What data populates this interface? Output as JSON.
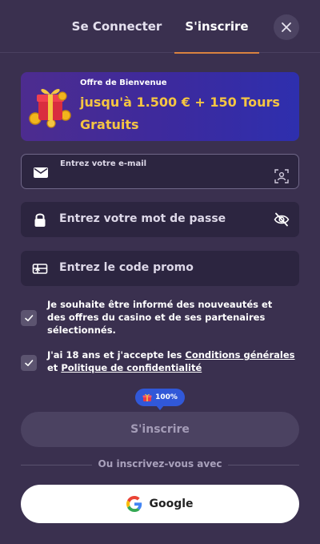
{
  "tabs": {
    "login": "Se Connecter",
    "register": "S'inscrire"
  },
  "promo": {
    "small": "Offre de Bienvenue",
    "big": "jusqu'à 1.500 € + 150 Tours Gratuits"
  },
  "fields": {
    "email_label": "Entrez votre e-mail",
    "password_placeholder": "Entrez votre mot de passe",
    "promo_placeholder": "Entrez le code promo"
  },
  "checkboxes": {
    "newsletter": "Je souhaite être informé des nouveautés et des offres du casino et de ses partenaires sélectionnés.",
    "age_prefix": "J'ai 18 ans et j'accepte les ",
    "terms_link": "Conditions générales",
    "and": " et ",
    "privacy_link": "Politique de confidentialité"
  },
  "badge": {
    "percent": "100%"
  },
  "submit_label": "S'inscrire",
  "divider_text": "Ou inscrivez-vous avec",
  "google_label": "Google",
  "colors": {
    "background": "#3a304f",
    "accent_tab": "#d98240",
    "promo_text": "#f5c542",
    "badge": "#3158d8"
  }
}
